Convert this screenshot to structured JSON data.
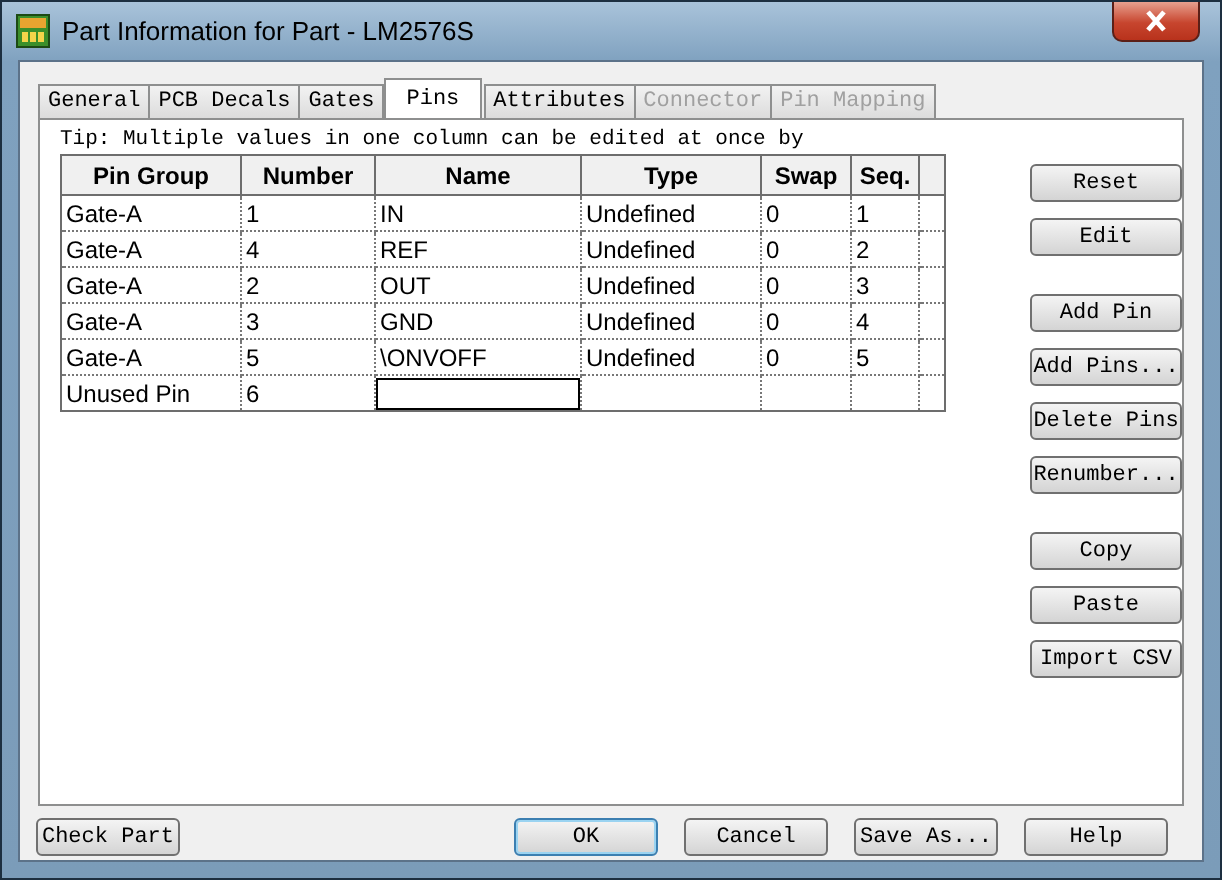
{
  "window": {
    "title": "Part Information for Part - LM2576S"
  },
  "tabs": [
    {
      "label": "General",
      "selected": false,
      "disabled": false
    },
    {
      "label": "PCB Decals",
      "selected": false,
      "disabled": false
    },
    {
      "label": "Gates",
      "selected": false,
      "disabled": false
    },
    {
      "label": "Pins",
      "selected": true,
      "disabled": false
    },
    {
      "label": "Attributes",
      "selected": false,
      "disabled": false
    },
    {
      "label": "Connector",
      "selected": false,
      "disabled": true
    },
    {
      "label": "Pin Mapping",
      "selected": false,
      "disabled": true
    }
  ],
  "tip": "Tip: Multiple values in one column can be edited at once by",
  "table": {
    "columns": [
      "Pin Group",
      "Number",
      "Name",
      "Type",
      "Swap",
      "Seq."
    ],
    "rows": [
      {
        "pin_group": "Gate-A",
        "number": "1",
        "name": "IN",
        "type": "Undefined",
        "swap": "0",
        "seq": "1",
        "editing": false
      },
      {
        "pin_group": "Gate-A",
        "number": "4",
        "name": "REF",
        "type": "Undefined",
        "swap": "0",
        "seq": "2",
        "editing": false
      },
      {
        "pin_group": "Gate-A",
        "number": "2",
        "name": "OUT",
        "type": "Undefined",
        "swap": "0",
        "seq": "3",
        "editing": false
      },
      {
        "pin_group": "Gate-A",
        "number": "3",
        "name": "GND",
        "type": "Undefined",
        "swap": "0",
        "seq": "4",
        "editing": false
      },
      {
        "pin_group": "Gate-A",
        "number": "5",
        "name": "\\ONVOFF",
        "type": "Undefined",
        "swap": "0",
        "seq": "5",
        "editing": false
      },
      {
        "pin_group": "Unused Pin",
        "number": "6",
        "editing": true
      }
    ]
  },
  "side_button_groups": [
    [
      "Reset",
      "Edit"
    ],
    [
      "Add Pin",
      "Add Pins...",
      "Delete Pins",
      "Renumber..."
    ],
    [
      "Copy",
      "Paste",
      "Import CSV"
    ]
  ],
  "footer": {
    "left_buttons": [
      {
        "label": "Check Part",
        "default": false
      }
    ],
    "right_buttons": [
      {
        "label": "OK",
        "default": true
      },
      {
        "label": "Cancel",
        "default": false
      },
      {
        "label": "Save As...",
        "default": false
      },
      {
        "label": "Help",
        "default": false
      }
    ]
  }
}
